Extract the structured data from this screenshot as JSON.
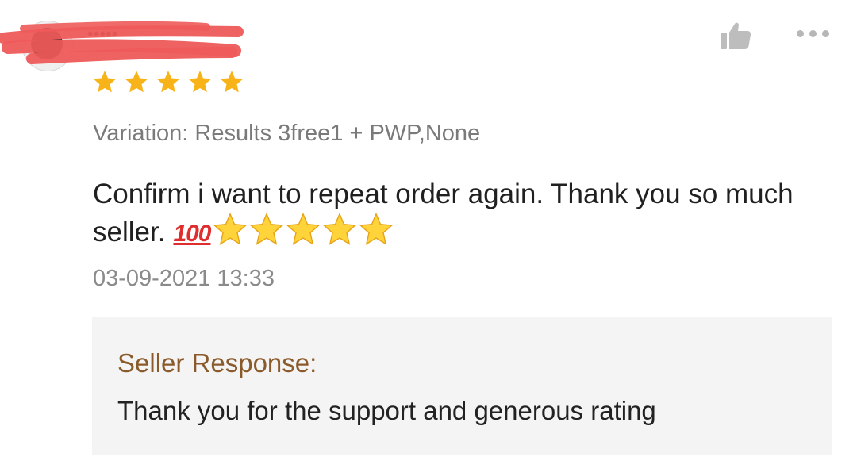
{
  "review": {
    "username": "•••••",
    "rating": 5,
    "rating_max": 5,
    "star_color": "#f8b319",
    "variation": "Variation: Results 3free1 + PWP,None",
    "comment": "Confirm i want to repeat order again. Thank you so much seller.",
    "comment_emoji_hundred": "100",
    "comment_star_emojis": 5,
    "timestamp": "03-09-2021 13:33"
  },
  "actions": {
    "like_icon": "thumbs-up-icon",
    "more_icon": "more-options-icon"
  },
  "seller_response": {
    "title": "Seller Response:",
    "text": "Thank you for the support and generous rating",
    "title_color": "#8a5a2b"
  }
}
